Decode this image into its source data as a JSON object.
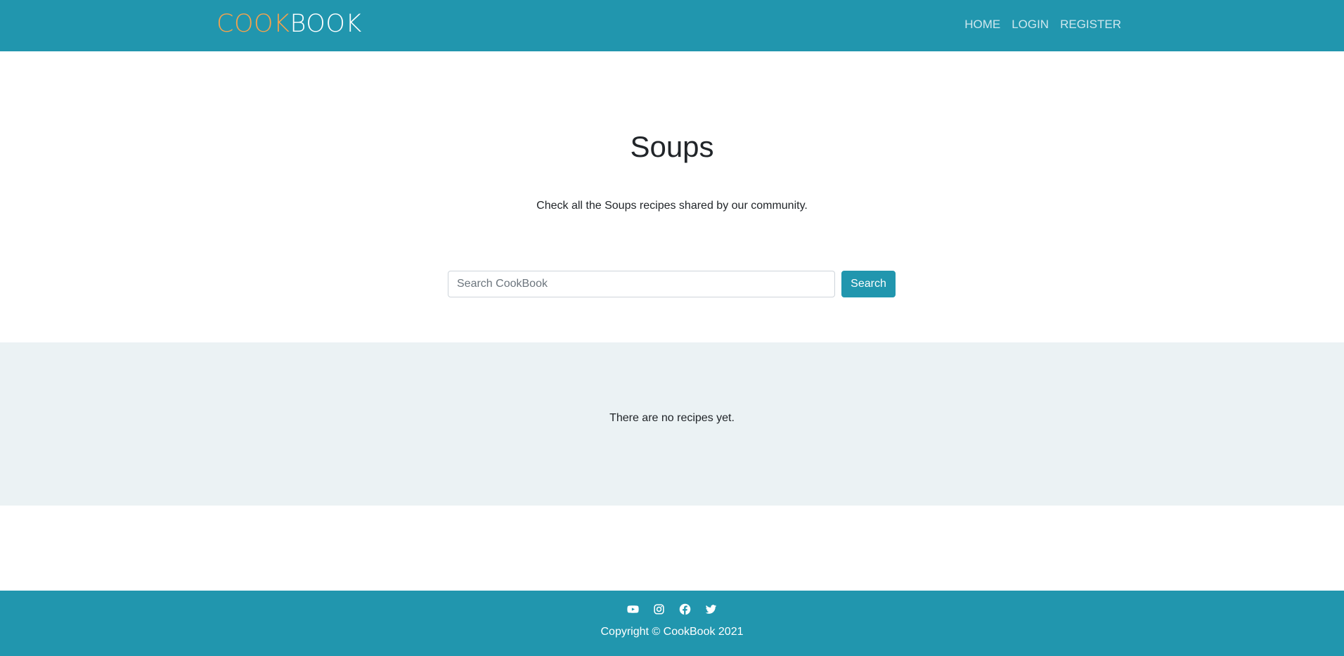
{
  "brand": {
    "part1": "COOK",
    "part2": "BOOK"
  },
  "nav": {
    "items": [
      {
        "label": "HOME"
      },
      {
        "label": "LOGIN"
      },
      {
        "label": "REGISTER"
      }
    ]
  },
  "hero": {
    "title": "Soups",
    "subtitle": "Check all the Soups recipes shared by our community."
  },
  "search": {
    "placeholder": "Search CookBook",
    "value": "",
    "button_label": "Search"
  },
  "recipes": {
    "empty_message": "There are no recipes yet."
  },
  "footer": {
    "social": [
      {
        "icon": "youtube-icon"
      },
      {
        "icon": "instagram-icon"
      },
      {
        "icon": "facebook-icon"
      },
      {
        "icon": "twitter-icon"
      }
    ],
    "copyright": "Copyright © CookBook 2021"
  },
  "colors": {
    "primary": "#2196ae",
    "brand_accent": "#f5a24c",
    "section_bg": "#ebf2f4",
    "nav_link": "#cfe7ee",
    "text": "#212529"
  }
}
